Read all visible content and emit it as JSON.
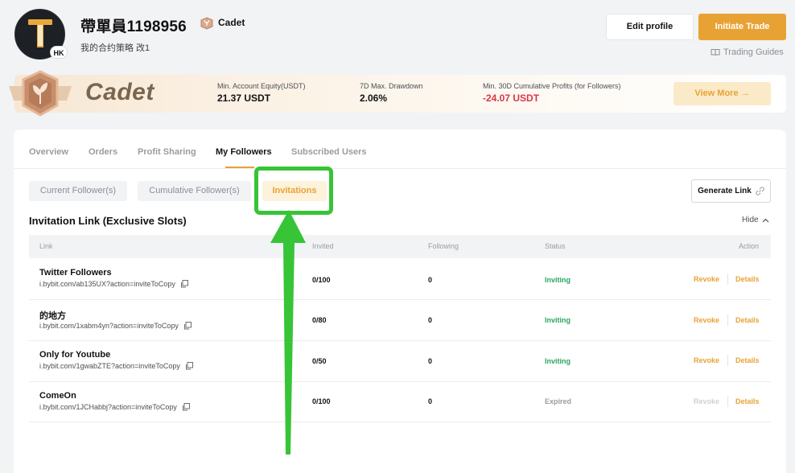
{
  "profile": {
    "username": "帶單員1198956",
    "level": "Cadet",
    "bio": "我的合约策略 改1",
    "region_badge": "HK",
    "edit_label": "Edit profile",
    "trade_label": "Initiate Trade",
    "guides_label": "Trading Guides"
  },
  "banner": {
    "title": "Cadet",
    "stats": [
      {
        "label": "Min. Account Equity(USDT)",
        "value": "21.37 USDT",
        "negative": false
      },
      {
        "label": "7D Max. Drawdown",
        "value": "2.06%",
        "negative": false
      },
      {
        "label": "Min. 30D Cumulative Profits (for Followers)",
        "value": "-24.07 USDT",
        "negative": true
      }
    ],
    "view_more_label": "View More →"
  },
  "tabs": [
    "Overview",
    "Orders",
    "Profit Sharing",
    "My Followers",
    "Subscribed Users"
  ],
  "active_tab": "My Followers",
  "subtabs": [
    "Current Follower(s)",
    "Cumulative Follower(s)",
    "Invitations"
  ],
  "active_subtab": "Invitations",
  "generate_link_label": "Generate Link",
  "section_title": "Invitation Link (Exclusive Slots)",
  "hide_label": "Hide",
  "table": {
    "headers": [
      "Link",
      "Invited",
      "Following",
      "Status",
      "Action"
    ],
    "rows": [
      {
        "name": "Twitter Followers",
        "url": "i.bybit.com/ab135UX?action=inviteToCopy",
        "invited": "0/100",
        "following": "0",
        "status": "Inviting",
        "revoke": "Revoke",
        "details": "Details"
      },
      {
        "name": "的地方",
        "url": "i.bybit.com/1xabm4yn?action=inviteToCopy",
        "invited": "0/80",
        "following": "0",
        "status": "Inviting",
        "revoke": "Revoke",
        "details": "Details"
      },
      {
        "name": "Only for Youtube",
        "url": "i.bybit.com/1gwabZTE?action=inviteToCopy",
        "invited": "0/50",
        "following": "0",
        "status": "Inviting",
        "revoke": "Revoke",
        "details": "Details"
      },
      {
        "name": "ComeOn",
        "url": "i.bybit.com/1JCHabbj?action=inviteToCopy",
        "invited": "0/100",
        "following": "0",
        "status": "Expired",
        "revoke": "Revoke",
        "details": "Details"
      }
    ]
  },
  "colors": {
    "accent": "#e8a234",
    "inviting": "#2aa55f",
    "negative": "#dc3545",
    "annotation": "#37c437"
  }
}
